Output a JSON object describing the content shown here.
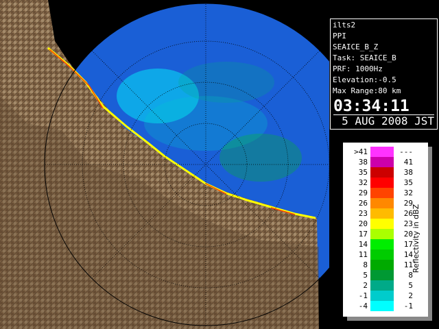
{
  "info": {
    "radar_name": "ilts2",
    "product": "PPI",
    "scan_name": "SEAICE_B_Z",
    "task": "Task: SEAICE_B",
    "prf": "PRF: 1000Hz",
    "elevation": "Elevation:-0.5",
    "max_range": "Max Range:80 km",
    "time": "03:34:11",
    "date": "5 AUG 2008 JST"
  },
  "legend": {
    "title": "Reflectivity in dBZ",
    "rows": [
      {
        "low": ">41",
        "high": "---",
        "color": "#ff33ff"
      },
      {
        "low": "38",
        "high": "41",
        "color": "#cc00aa"
      },
      {
        "low": "35",
        "high": "38",
        "color": "#cc0000"
      },
      {
        "low": "32",
        "high": "35",
        "color": "#ff0000"
      },
      {
        "low": "29",
        "high": "32",
        "color": "#ff4400"
      },
      {
        "low": "26",
        "high": "29",
        "color": "#ff8800"
      },
      {
        "low": "23",
        "high": "26",
        "color": "#ffbb00"
      },
      {
        "low": "20",
        "high": "23",
        "color": "#ffff00"
      },
      {
        "low": "17",
        "high": "20",
        "color": "#aaff00"
      },
      {
        "low": "14",
        "high": "17",
        "color": "#00ee00"
      },
      {
        "low": "11",
        "high": "14",
        "color": "#00cc00"
      },
      {
        "low": "8",
        "high": "11",
        "color": "#00aa00"
      },
      {
        "low": "5",
        "high": "8",
        "color": "#009933"
      },
      {
        "low": "2",
        "high": "5",
        "color": "#00aa88"
      },
      {
        "low": "-1",
        "high": "2",
        "color": "#00cccc"
      },
      {
        "low": "-4",
        "high": "-1",
        "color": "#00ffff"
      }
    ]
  },
  "colors": {
    "sea": "#1a5fd6",
    "land": "#8b6e4e",
    "range_ring": "#000000"
  }
}
